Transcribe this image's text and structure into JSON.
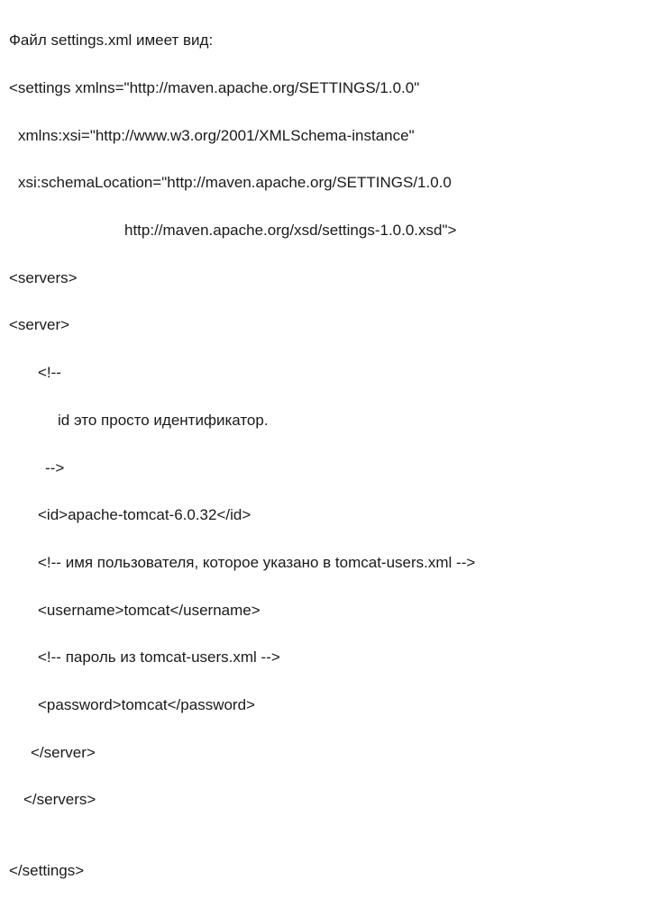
{
  "lines": {
    "l0": "Файл settings.xml имеет вид:",
    "l1": "<settings xmlns=\"http://maven.apache.org/SETTINGS/1.0.0\"",
    "l2": "xmlns:xsi=\"http://www.w3.org/2001/XMLSchema-instance\"",
    "l3": "xsi:schemaLocation=\"http://maven.apache.org/SETTINGS/1.0.0",
    "l4": "http://maven.apache.org/xsd/settings-1.0.0.xsd\">",
    "l5": "<servers>",
    "l6": "<server>",
    "l7": "<!--",
    "l8": "id это просто идентификатор.",
    "l9": "-->",
    "l10": "<id>apache-tomcat-6.0.32</id>",
    "l11": "<!-- имя пользователя, которое указано в tomcat-users.xml -->",
    "l12": "<username>tomcat</username>",
    "l13": "<!-- пароль из tomcat-users.xml -->",
    "l14": "<password>tomcat</password>",
    "l15": "</server>",
    "l16": "</servers>",
    "l17": "",
    "l18": "</settings>"
  }
}
